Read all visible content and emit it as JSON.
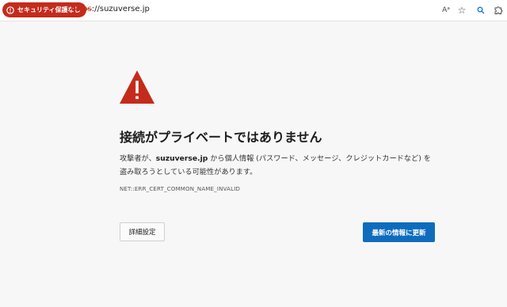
{
  "address_bar": {
    "security_badge": "セキュリティ保護なし",
    "url_scheme": "https",
    "url_rest": "://suzuverse.jp",
    "read_aloud_icon": "Aᵃ",
    "favorite_icon": "☆",
    "search_icon": "search-icon",
    "extensions_icon": "puzzle-icon"
  },
  "error": {
    "title": "接続がプライベートではありません",
    "desc_prefix": "攻撃者が、",
    "domain": "suzuverse.jp",
    "desc_suffix": " から個人情報 (パスワード、メッセージ、クレジットカードなど) を盗み取ろうとしている可能性があります。",
    "code": "NET::ERR_CERT_COMMON_NAME_INVALID"
  },
  "buttons": {
    "advanced": "詳細設定",
    "refresh": "最新の情報に更新"
  },
  "colors": {
    "warning_red": "#c42b1c",
    "primary_blue": "#0f6cbd"
  }
}
